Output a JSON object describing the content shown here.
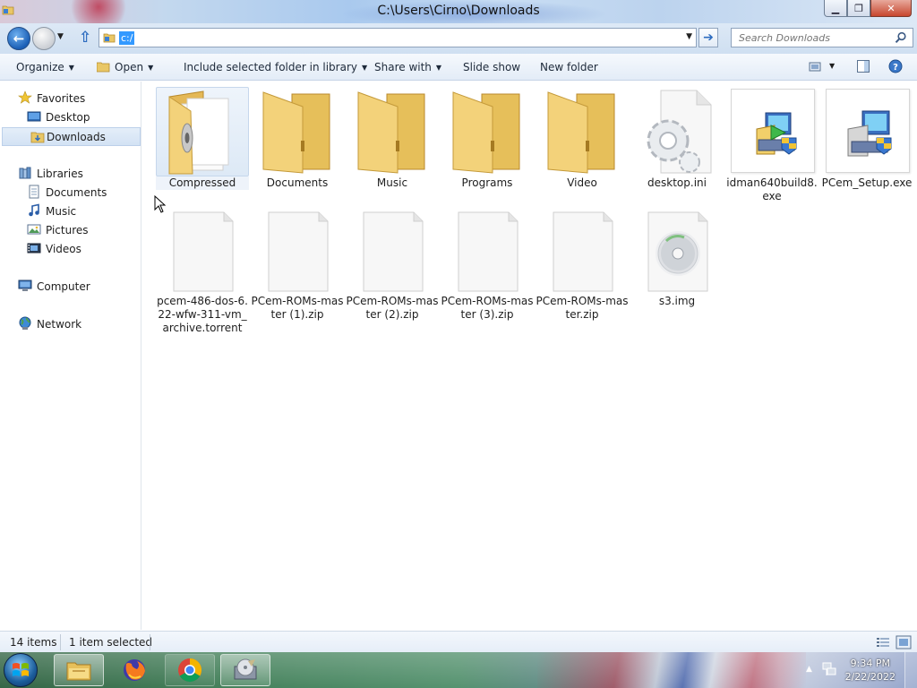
{
  "window": {
    "title": "C:\\Users\\Cirno\\Downloads",
    "controls": [
      "minimize",
      "maximize",
      "close"
    ]
  },
  "navbar": {
    "address_value": "c:/",
    "search_placeholder": "Search Downloads"
  },
  "toolbar": {
    "organize": "Organize",
    "open": "Open",
    "include": "Include selected folder in library",
    "share": "Share with",
    "slideshow": "Slide show",
    "newfolder": "New folder"
  },
  "sidebar": {
    "favorites": "Favorites",
    "desktop": "Desktop",
    "downloads": "Downloads",
    "libraries": "Libraries",
    "documents": "Documents",
    "music": "Music",
    "pictures": "Pictures",
    "videos": "Videos",
    "computer": "Computer",
    "network": "Network"
  },
  "files": [
    {
      "name": "Compressed",
      "type": "zip-folder",
      "selected": true
    },
    {
      "name": "Documents",
      "type": "folder"
    },
    {
      "name": "Music",
      "type": "folder"
    },
    {
      "name": "Programs",
      "type": "folder"
    },
    {
      "name": "Video",
      "type": "folder"
    },
    {
      "name": "desktop.ini",
      "type": "settings-file"
    },
    {
      "name": "idman640build8.exe",
      "type": "installer"
    },
    {
      "name": "PCem_Setup.exe",
      "type": "installer"
    },
    {
      "name": "pcem-486-dos-6.22-wfw-311-vm_archive.torrent",
      "type": "file"
    },
    {
      "name": "PCem-ROMs-master (1).zip",
      "type": "file"
    },
    {
      "name": "PCem-ROMs-master (2).zip",
      "type": "file"
    },
    {
      "name": "PCem-ROMs-master (3).zip",
      "type": "file"
    },
    {
      "name": "PCem-ROMs-master.zip",
      "type": "file"
    },
    {
      "name": "s3.img",
      "type": "disc-image"
    }
  ],
  "status": {
    "count": "14 items",
    "selection": "1 item selected"
  },
  "taskbar": {
    "time": "9:34 PM",
    "date": "2/22/2022",
    "apps": [
      "windows-explorer",
      "firefox",
      "chrome",
      "setup-wizard"
    ]
  },
  "colors": {
    "selection_bg": "#dde9f6",
    "address_highlight": "#3399ff",
    "folder_yellow": "#f3d27a"
  }
}
